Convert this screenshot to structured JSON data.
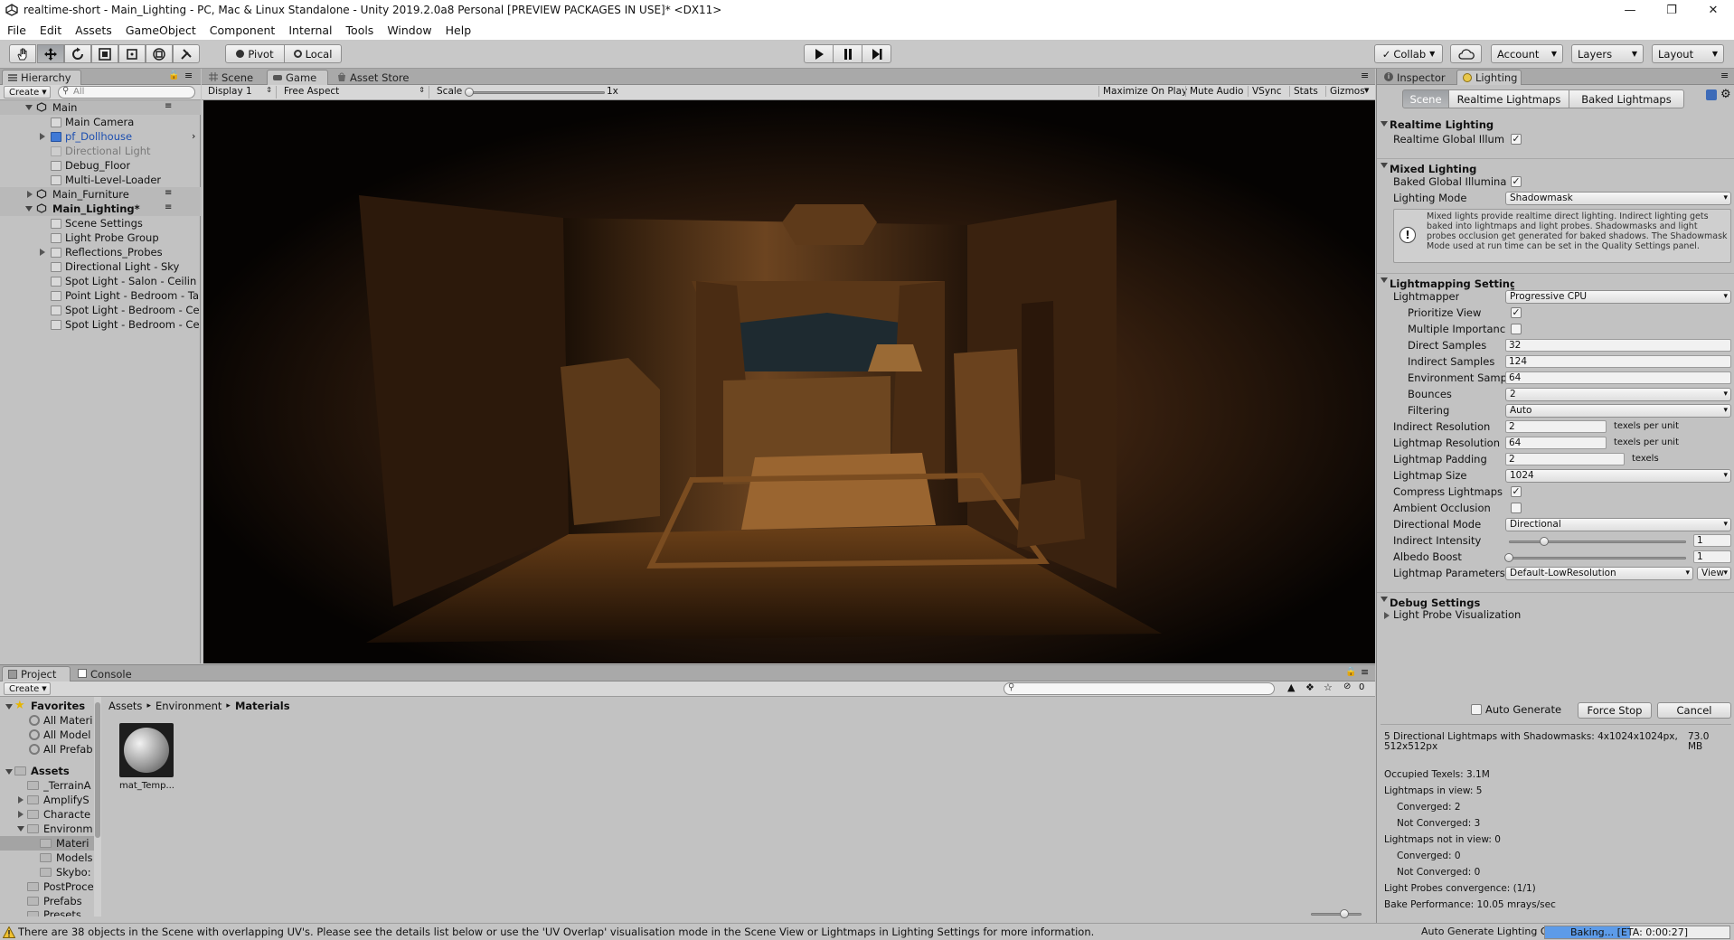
{
  "window": {
    "title": "realtime-short - Main_Lighting - PC, Mac & Linux Standalone - Unity 2019.2.0a8 Personal [PREVIEW PACKAGES IN USE]* <DX11>"
  },
  "menu": [
    "File",
    "Edit",
    "Assets",
    "GameObject",
    "Component",
    "Internal",
    "Tools",
    "Window",
    "Help"
  ],
  "toolbar": {
    "pivot": "Pivot",
    "local": "Local",
    "collab": "Collab",
    "account": "Account",
    "layers": "Layers",
    "layout": "Layout"
  },
  "hierarchy": {
    "tab": "Hierarchy",
    "create": "Create",
    "search_placeholder": "All",
    "items": [
      {
        "label": "Main"
      },
      {
        "label": "Main Camera"
      },
      {
        "label": "pf_Dollhouse"
      },
      {
        "label": "Directional Light"
      },
      {
        "label": "Debug_Floor"
      },
      {
        "label": "Multi-Level-Loader"
      },
      {
        "label": "Main_Furniture"
      },
      {
        "label": "Main_Lighting*"
      },
      {
        "label": "Scene Settings"
      },
      {
        "label": "Light Probe Group"
      },
      {
        "label": "Reflections_Probes"
      },
      {
        "label": "Directional Light - Sky"
      },
      {
        "label": "Spot Light - Salon - Ceilin"
      },
      {
        "label": "Point Light - Bedroom - Ta"
      },
      {
        "label": "Spot Light - Bedroom - Ce"
      },
      {
        "label": "Spot Light - Bedroom - Ce"
      }
    ]
  },
  "center_tabs": [
    "Scene",
    "Game",
    "Asset Store"
  ],
  "game_bar": {
    "display": "Display 1",
    "aspect": "Free Aspect",
    "scale_label": "Scale",
    "scale_value": "1x",
    "maximize": "Maximize On Play",
    "mute": "Mute Audio",
    "vsync": "VSync",
    "stats": "Stats",
    "gizmos": "Gizmos"
  },
  "inspector_tabs": [
    "Inspector",
    "Lighting"
  ],
  "lighting": {
    "subtabs": [
      "Scene",
      "Realtime Lightmaps",
      "Baked Lightmaps"
    ],
    "realtime_header": "Realtime Lighting",
    "realtime_gi": "Realtime Global Illum",
    "mixed_header": "Mixed Lighting",
    "baked_gi": "Baked Global Illumina",
    "lighting_mode_label": "Lighting Mode",
    "lighting_mode": "Shadowmask",
    "info": "Mixed lights provide realtime direct lighting. Indirect lighting gets baked into lightmaps and light probes. Shadowmasks and light probes occlusion get generated for baked shadows. The Shadowmask Mode used at run time can be set in the Quality Settings panel.",
    "lightmapping_header": "Lightmapping Settings",
    "lightmapper_label": "Lightmapper",
    "lightmapper": "Progressive CPU",
    "prioritize_view": "Prioritize View",
    "multiple_importance": "Multiple Importanc",
    "direct_samples_label": "Direct Samples",
    "direct_samples": "32",
    "indirect_samples_label": "Indirect Samples",
    "indirect_samples": "124",
    "env_samples_label": "Environment Samp",
    "env_samples": "64",
    "bounces_label": "Bounces",
    "bounces": "2",
    "filtering_label": "Filtering",
    "filtering": "Auto",
    "indirect_res_label": "Indirect Resolution",
    "indirect_res": "2",
    "texels_per_unit": "texels per unit",
    "lightmap_res_label": "Lightmap Resolution",
    "lightmap_res": "64",
    "lightmap_padding_label": "Lightmap Padding",
    "lightmap_padding": "2",
    "texels": "texels",
    "lightmap_size_label": "Lightmap Size",
    "lightmap_size": "1024",
    "compress_label": "Compress Lightmaps",
    "ao_label": "Ambient Occlusion",
    "directional_label": "Directional Mode",
    "directional": "Directional",
    "indirect_intensity_label": "Indirect Intensity",
    "indirect_intensity": "1",
    "indirect_intensity_level": 0.2,
    "albedo_label": "Albedo Boost",
    "albedo": "1",
    "albedo_level": 0.0,
    "params_label": "Lightmap Parameters",
    "params": "Default-LowResolution",
    "view_btn": "View",
    "debug_header": "Debug Settings",
    "light_probe_vis": "Light Probe Visualization",
    "auto_generate": "Auto Generate",
    "force_stop": "Force Stop",
    "cancel": "Cancel",
    "stats": {
      "lightmaps_line1": "5 Directional Lightmaps with Shadowmasks: 4x1024x1024px,",
      "lightmaps_line2": "512x512px",
      "size1": "73.0",
      "size2": "MB",
      "occupied": "Occupied Texels: 3.1M",
      "in_view": "Lightmaps in view: 5",
      "converged_a": "Converged: 2",
      "not_converged_a": "Not Converged: 3",
      "not_in_view": "Lightmaps not in view: 0",
      "converged_b": "Converged: 0",
      "not_converged_b": "Not Converged: 0",
      "probes": "Light Probes convergence: (1/1)",
      "perf": "Bake Performance: 10.05 mrays/sec"
    }
  },
  "project": {
    "tabs": [
      "Project",
      "Console"
    ],
    "create": "Create",
    "hidden_count": "0",
    "favorites_header": "Favorites",
    "favorites": [
      "All Materi",
      "All Model",
      "All Prefab"
    ],
    "assets_header": "Assets",
    "folders": [
      "_TerrainA",
      "AmplifyS",
      "Characte",
      "Environm",
      "Materi",
      "Models",
      "Skybo:",
      "PostProce",
      "Prefabs",
      "Presets"
    ],
    "breadcrumb": [
      "Assets",
      "Environment",
      "Materials"
    ],
    "asset_name": "mat_Temp..."
  },
  "status": {
    "warning": "There are 38 objects in the Scene with overlapping UV's. Please see the details list below or use the 'UV Overlap' visualisation mode in the Scene View or Lightmaps in Lighting Settings for more information.",
    "auto_gen": "Auto Generate Lighting Off",
    "baking": "Baking... [ETA: 0:00:27]",
    "baking_progress": 0.46
  }
}
